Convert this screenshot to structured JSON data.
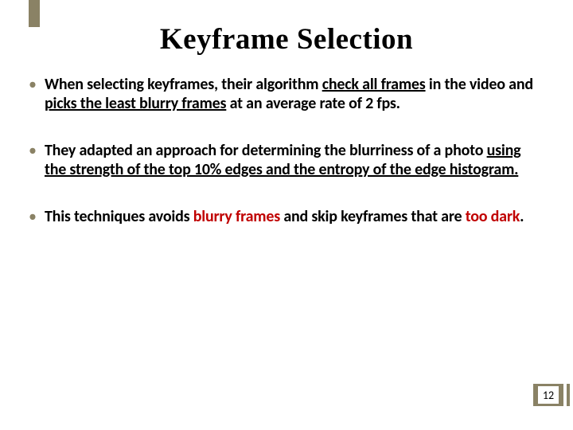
{
  "accent_color": "#8a8265",
  "title": "Keyframe Selection",
  "bullets": [
    {
      "parts": [
        {
          "text": "When selecting keyframes, their algorithm ",
          "cls": ""
        },
        {
          "text": "check all frames",
          "cls": "u"
        },
        {
          "text": " in the video and ",
          "cls": ""
        },
        {
          "text": "picks the least blurry frames",
          "cls": "u"
        },
        {
          "text": " at an average rate of 2 fps.",
          "cls": ""
        }
      ]
    },
    {
      "parts": [
        {
          "text": "They adapted an approach for determining the blurriness of a photo ",
          "cls": ""
        },
        {
          "text": "using the strength of the top 10% edges and the entropy of the edge histogram.",
          "cls": "u"
        }
      ]
    },
    {
      "parts": [
        {
          "text": "This techniques avoids ",
          "cls": ""
        },
        {
          "text": "blurry frames ",
          "cls": "red"
        },
        {
          "text": "and skip keyframes that are ",
          "cls": ""
        },
        {
          "text": "too dark",
          "cls": "red"
        },
        {
          "text": ".",
          "cls": ""
        }
      ]
    }
  ],
  "page_number": "12"
}
